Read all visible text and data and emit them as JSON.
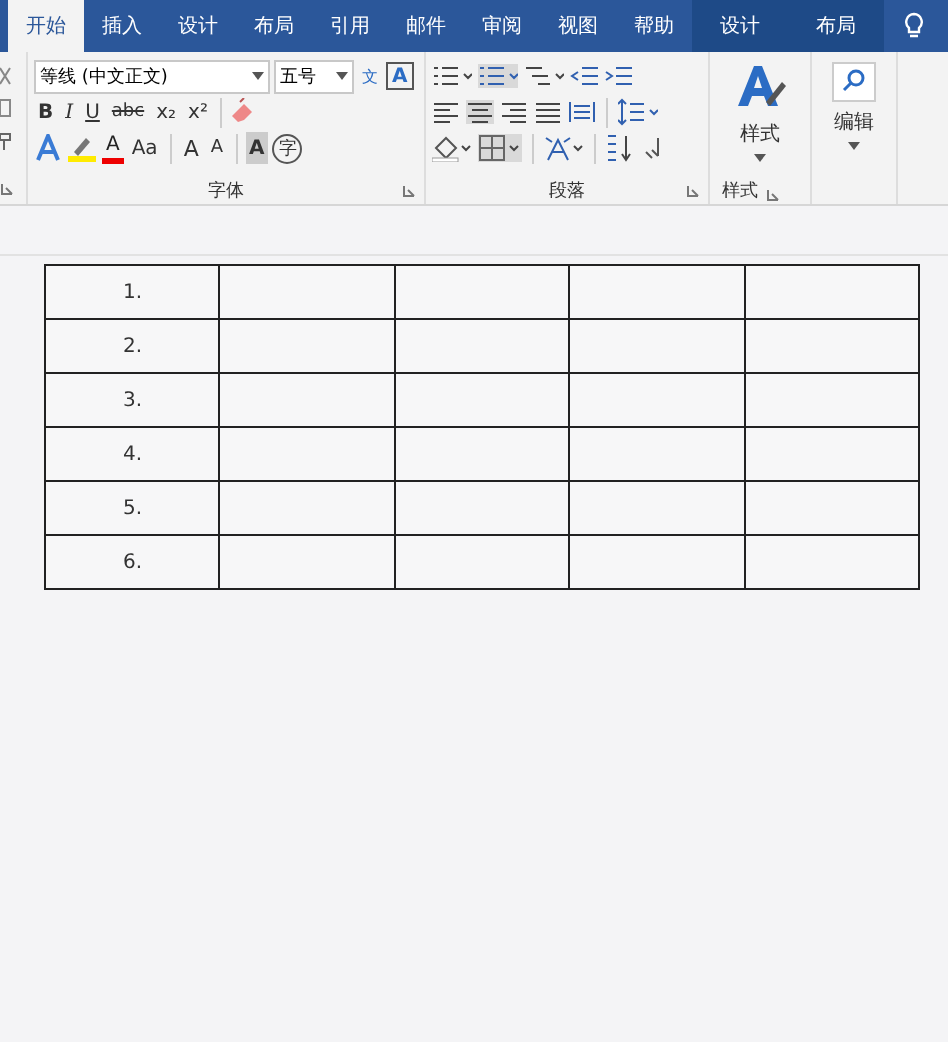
{
  "tabs": [
    {
      "label": "开始",
      "selected": true,
      "kind": "normal"
    },
    {
      "label": "插入",
      "selected": false,
      "kind": "normal"
    },
    {
      "label": "设计",
      "selected": false,
      "kind": "normal"
    },
    {
      "label": "布局",
      "selected": false,
      "kind": "normal"
    },
    {
      "label": "引用",
      "selected": false,
      "kind": "normal"
    },
    {
      "label": "邮件",
      "selected": false,
      "kind": "normal"
    },
    {
      "label": "审阅",
      "selected": false,
      "kind": "normal"
    },
    {
      "label": "视图",
      "selected": false,
      "kind": "normal"
    },
    {
      "label": "帮助",
      "selected": false,
      "kind": "normal"
    },
    {
      "label": "设计",
      "selected": false,
      "kind": "contextual"
    },
    {
      "label": "布局",
      "selected": false,
      "kind": "contextual"
    }
  ],
  "font_group": {
    "label": "字体",
    "font_name": "等线 (中文正文)",
    "font_size": "五号",
    "phonetic": "文",
    "border_char": "A",
    "format_buttons": [
      "B",
      "I",
      "U",
      "abc",
      "x₂",
      "x²"
    ],
    "text_color_button": "A",
    "case_button": "Aa",
    "grow_button": "A",
    "shrink_button": "A",
    "shading_button": "A",
    "enclose_button": "字"
  },
  "paragraph_group": {
    "label": "段落"
  },
  "styles_group": {
    "label": "样式",
    "button": "样式"
  },
  "editing": {
    "button": "编辑"
  },
  "table": {
    "rows": [
      {
        "number": "1."
      },
      {
        "number": "2."
      },
      {
        "number": "3."
      },
      {
        "number": "4."
      },
      {
        "number": "5."
      },
      {
        "number": "6."
      }
    ]
  }
}
